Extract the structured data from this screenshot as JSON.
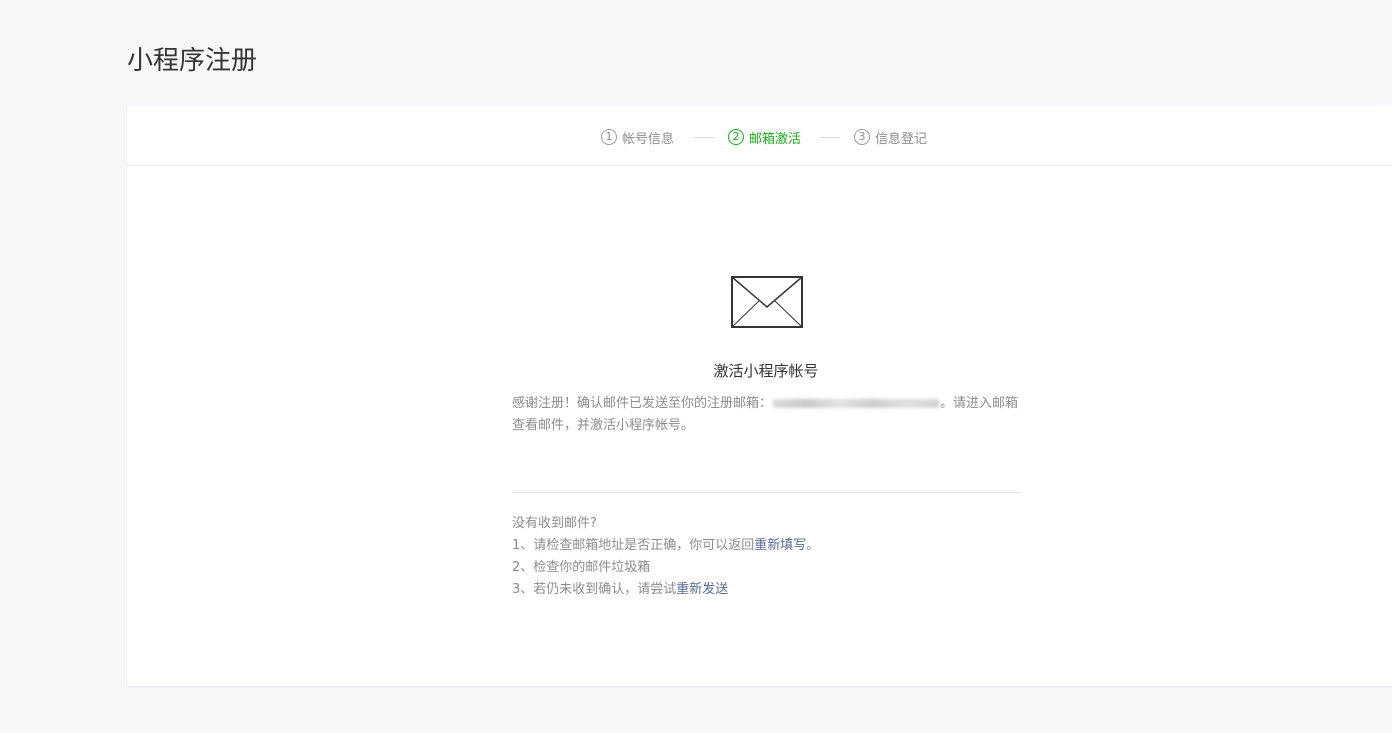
{
  "page": {
    "title": "小程序注册"
  },
  "steps": [
    {
      "number": "1",
      "label": "帐号信息",
      "state": "done"
    },
    {
      "number": "2",
      "label": "邮箱激活",
      "state": "active"
    },
    {
      "number": "3",
      "label": "信息登记",
      "state": "pending"
    }
  ],
  "main": {
    "icon": "envelope-icon",
    "title": "激活小程序帐号",
    "desc_before": "感谢注册！确认邮件已发送至你的注册邮箱：",
    "desc_after": "。请进入邮箱查看邮件，并激活小程序帐号。"
  },
  "help": {
    "heading": "没有收到邮件?",
    "line1_text": "1、请检查邮箱地址是否正确，你可以返回",
    "line1_link": "重新填写",
    "line1_end": "。",
    "line2_text": "2、检查你的邮件垃圾箱",
    "line3_text": "3、若仍未收到确认，请尝试",
    "line3_link": "重新发送"
  },
  "colors": {
    "accent": "#1aad19",
    "link": "#576b95",
    "background": "#f6f7f9"
  }
}
